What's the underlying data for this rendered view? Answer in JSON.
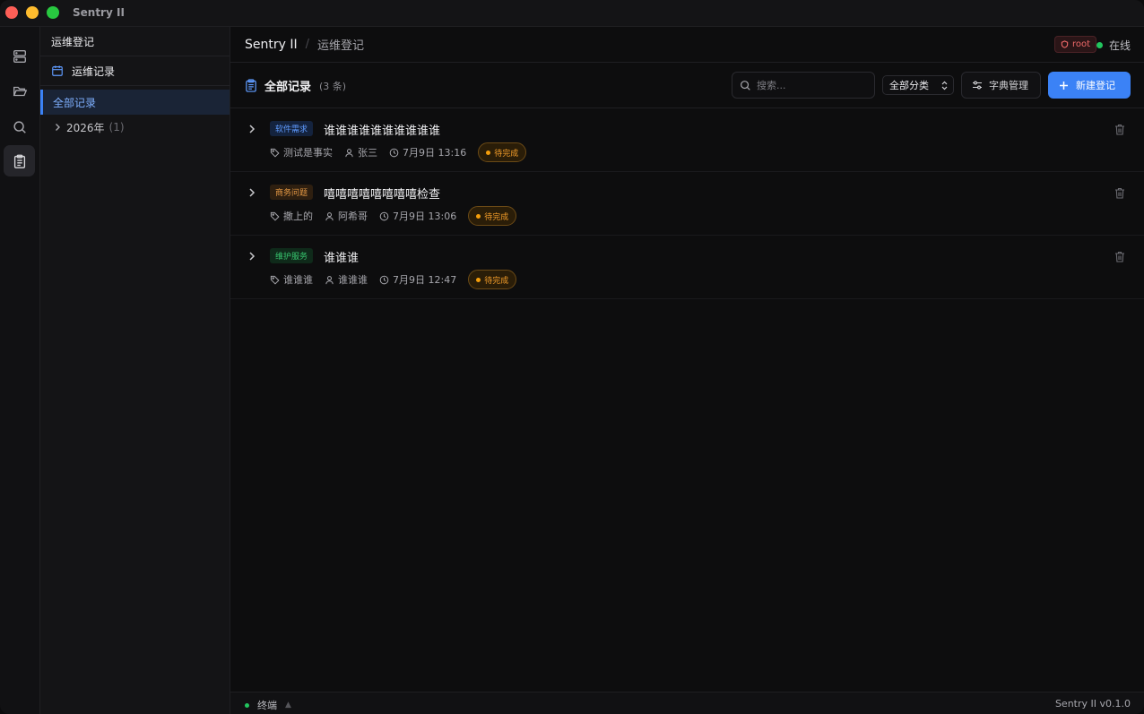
{
  "window": {
    "title": "Sentry II"
  },
  "rail": {
    "icons": [
      "server-icon",
      "folder-open-icon",
      "search-icon",
      "clipboard-icon"
    ],
    "active": "clipboard-icon"
  },
  "sidebar": {
    "header": "运维登记",
    "section_label": "运维记录",
    "all_label": "全部记录",
    "years": [
      {
        "label": "2026年",
        "count": "(1)"
      }
    ]
  },
  "topbar": {
    "app_name": "Sentry II",
    "separator": "/",
    "page_name": "运维登记",
    "user_badge": "root",
    "status": "在线"
  },
  "toolbar": {
    "title": "全部记录",
    "count": "(3 条)",
    "search_placeholder": "搜索...",
    "category_select": "全部分类",
    "dict_button": "字典管理",
    "new_button": "新建登记"
  },
  "records": [
    {
      "category": "软件需求",
      "category_color": "blue",
      "title": "谁谁谁谁谁谁谁谁谁谁",
      "tag": "测试是事实",
      "user": "张三",
      "time": "7月9日 13:16",
      "status": "待完成"
    },
    {
      "category": "商务问题",
      "category_color": "orange",
      "title": "嘻嘻嘻嘻嘻嘻嘻嘻检查",
      "tag": "撒上的",
      "user": "阿希哥",
      "time": "7月9日 13:06",
      "status": "待完成"
    },
    {
      "category": "维护服务",
      "category_color": "green",
      "title": "谁谁谁",
      "tag": "谁谁谁",
      "user": "谁谁谁",
      "time": "7月9日 12:47",
      "status": "待完成"
    }
  ],
  "statusbar": {
    "terminal": "终端",
    "caret": "▲",
    "version": "Sentry II v0.1.0"
  },
  "colors": {
    "accent": "#3b82f6",
    "online": "#22c55e",
    "pending": "#f59e0b",
    "danger": "#f06a6a"
  }
}
